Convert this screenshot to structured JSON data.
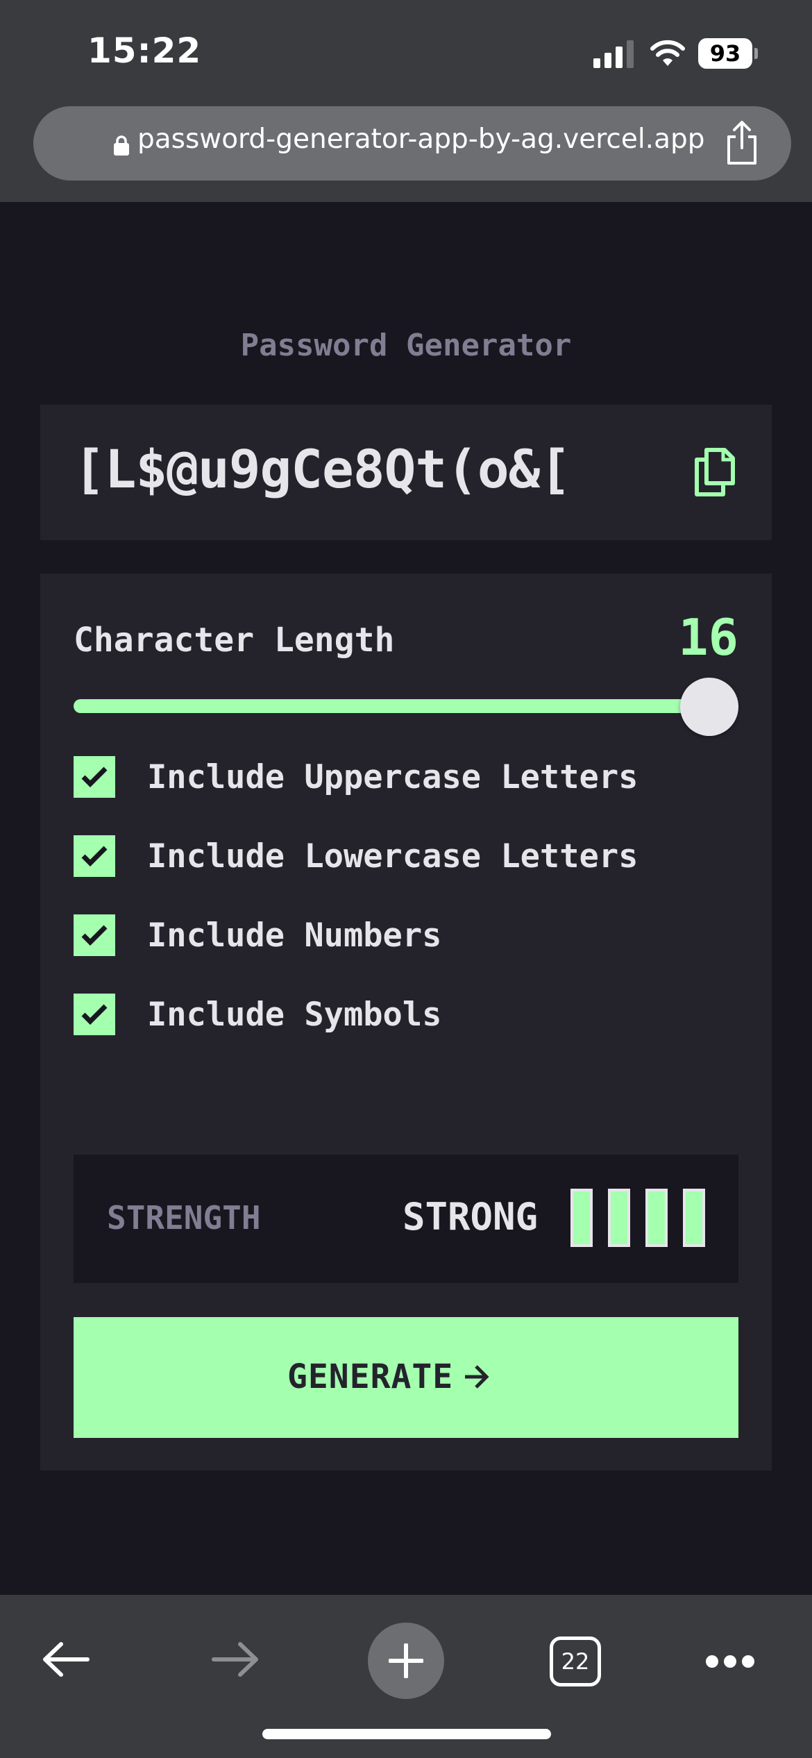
{
  "status_bar": {
    "time": "15:22",
    "battery": "93"
  },
  "browser": {
    "url": "password-generator-app-by-ag.vercel.app",
    "tab_count": "22",
    "icons": [
      "lock-icon",
      "share-icon",
      "back-arrow-icon",
      "forward-arrow-icon",
      "plus-icon",
      "tabs-icon",
      "more-icon"
    ]
  },
  "app": {
    "title": "Password Generator",
    "password": "[L$@u9gCe8Qt(o&[",
    "length": {
      "label": "Character Length",
      "value": "16",
      "fraction": 1.0
    },
    "options": [
      {
        "label": "Include Uppercase Letters",
        "checked": true
      },
      {
        "label": "Include Lowercase Letters",
        "checked": true
      },
      {
        "label": "Include Numbers",
        "checked": true
      },
      {
        "label": "Include Symbols",
        "checked": true
      }
    ],
    "strength": {
      "label": "STRENGTH",
      "value": "STRONG",
      "filled_bars": 4,
      "total_bars": 4
    },
    "generate_label": "GENERATE"
  },
  "colors": {
    "accent": "#A4FFAF",
    "background": "#18171F",
    "panel": "#24232C",
    "text": "#E6E5EA",
    "muted": "#817D92"
  }
}
